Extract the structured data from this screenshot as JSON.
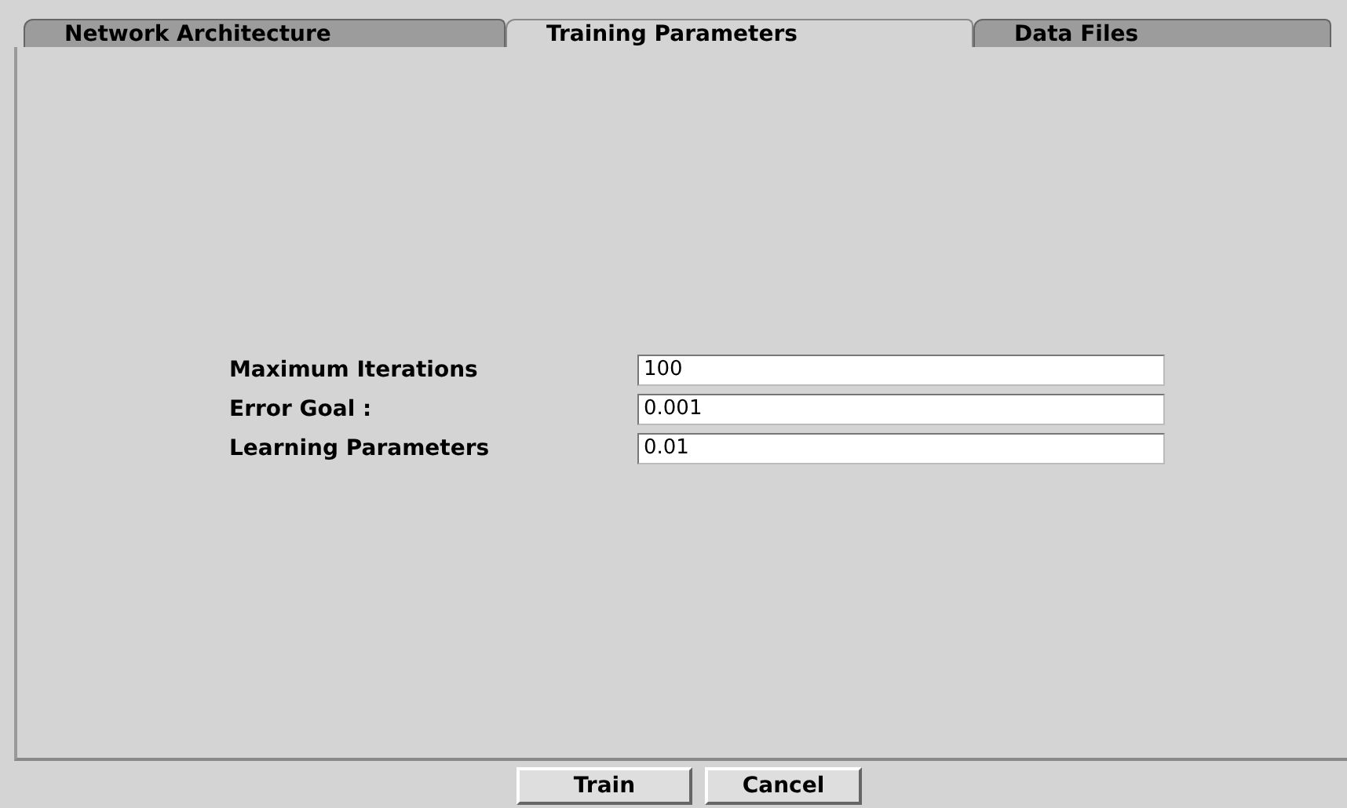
{
  "tabs": [
    {
      "label": "Network Architecture",
      "selected": false
    },
    {
      "label": "Training Parameters",
      "selected": true
    },
    {
      "label": "Data Files",
      "selected": false
    }
  ],
  "fields": [
    {
      "label": "Maximum Iterations",
      "value": "100"
    },
    {
      "label": "Error Goal  :",
      "value": "0.001"
    },
    {
      "label": "Learning Parameters",
      "value": "0.01"
    }
  ],
  "buttons": [
    "Train",
    "Cancel"
  ]
}
